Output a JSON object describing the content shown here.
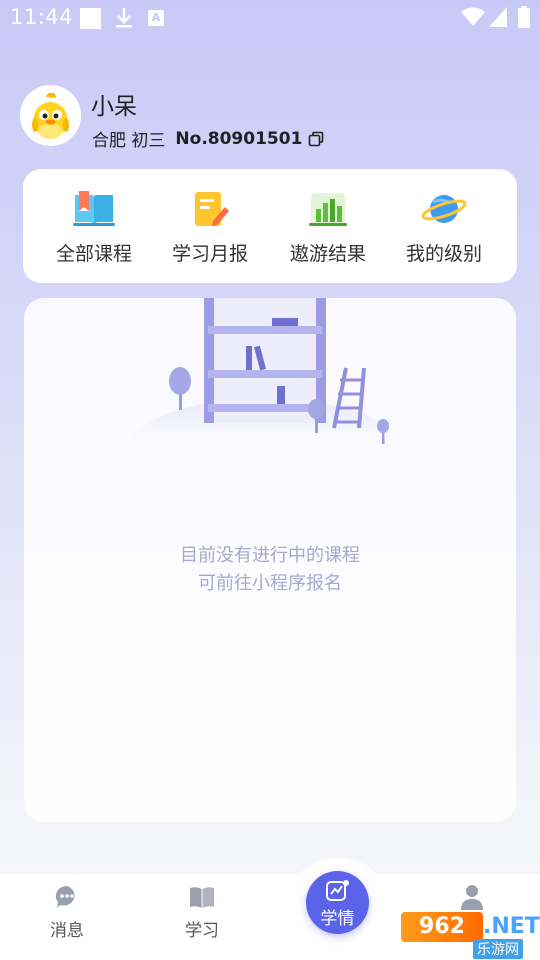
{
  "status_bar": {
    "time": "11:44",
    "notification_icon": "A"
  },
  "profile": {
    "name": "小呆",
    "location_grade": "合肥 初三",
    "student_no": "No.80901501"
  },
  "quick_actions": [
    {
      "label": "全部课程",
      "icon": "book-icon"
    },
    {
      "label": "学习月报",
      "icon": "report-icon"
    },
    {
      "label": "遨游结果",
      "icon": "bar-chart-icon"
    },
    {
      "label": "我的级别",
      "icon": "planet-icon"
    }
  ],
  "empty_state": {
    "line1": "目前没有进行中的课程",
    "line2": "可前往小程序报名"
  },
  "bottom_nav": {
    "items": [
      {
        "label": "消息",
        "icon": "chat-icon"
      },
      {
        "label": "学习",
        "icon": "open-book-icon"
      },
      {
        "label": "学情",
        "icon": "trend-icon",
        "active": true
      },
      {
        "label": "",
        "icon": "user-icon"
      }
    ]
  },
  "watermark": {
    "logo": "962",
    "net": ".NET",
    "site": "乐游网"
  },
  "colors": {
    "accent": "#5a63ea",
    "background_top": "#c9c9f7",
    "empty_text": "#a7a7cf"
  }
}
